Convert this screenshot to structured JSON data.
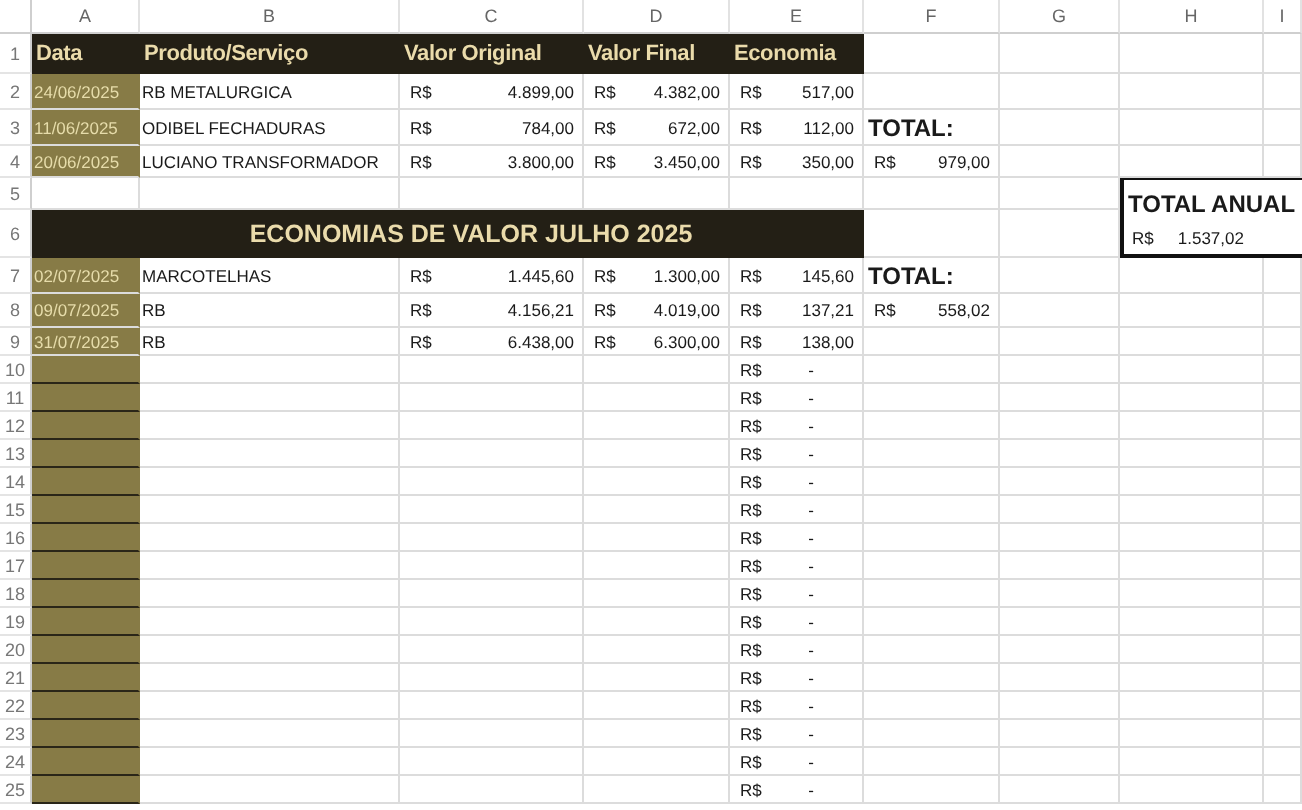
{
  "columns": [
    "A",
    "B",
    "C",
    "D",
    "E",
    "F",
    "G",
    "H",
    "I"
  ],
  "rows": [
    {
      "number": "1",
      "kind": "header",
      "labels": [
        "Data",
        "Produto/Serviço",
        "Valor Original",
        "Valor Final",
        "Economia"
      ]
    },
    {
      "number": "2",
      "kind": "entry",
      "date": "24/06/2025",
      "product": "RB METALURGICA",
      "original": {
        "symbol": "R$",
        "amount": "4.899,00"
      },
      "final": {
        "symbol": "R$",
        "amount": "4.382,00"
      },
      "economy": {
        "symbol": "R$",
        "amount": "517,00"
      }
    },
    {
      "number": "3",
      "kind": "entry",
      "date": "11/06/2025",
      "product": "ODIBEL FECHADURAS",
      "original": {
        "symbol": "R$",
        "amount": "784,00"
      },
      "final": {
        "symbol": "R$",
        "amount": "672,00"
      },
      "economy": {
        "symbol": "R$",
        "amount": "112,00"
      },
      "extra": {
        "kind": "total-label",
        "text": "TOTAL:"
      }
    },
    {
      "number": "4",
      "kind": "entry",
      "date": "20/06/2025",
      "product": "LUCIANO TRANSFORMADOR",
      "original": {
        "symbol": "R$",
        "amount": "3.800,00"
      },
      "final": {
        "symbol": "R$",
        "amount": "3.450,00"
      },
      "economy": {
        "symbol": "R$",
        "amount": "350,00"
      },
      "extra": {
        "kind": "amount",
        "symbol": "R$",
        "amount": "979,00"
      }
    },
    {
      "number": "5",
      "kind": "blank"
    },
    {
      "number": "6",
      "kind": "banner",
      "title": "ECONOMIAS DE VALOR JULHO 2025"
    },
    {
      "number": "7",
      "kind": "entry",
      "date": "02/07/2025",
      "product": "MARCOTELHAS",
      "original": {
        "symbol": "R$",
        "amount": "1.445,60"
      },
      "final": {
        "symbol": "R$",
        "amount": "1.300,00"
      },
      "economy": {
        "symbol": "R$",
        "amount": "145,60"
      },
      "extra": {
        "kind": "total-label",
        "text": "TOTAL:"
      }
    },
    {
      "number": "8",
      "kind": "entry",
      "date": "09/07/2025",
      "product": "RB",
      "original": {
        "symbol": "R$",
        "amount": "4.156,21"
      },
      "final": {
        "symbol": "R$",
        "amount": "4.019,00"
      },
      "economy": {
        "symbol": "R$",
        "amount": "137,21"
      },
      "extra": {
        "kind": "amount",
        "symbol": "R$",
        "amount": "558,02"
      }
    },
    {
      "number": "9",
      "kind": "entry",
      "date": "31/07/2025",
      "product": "RB",
      "original": {
        "symbol": "R$",
        "amount": "6.438,00"
      },
      "final": {
        "symbol": "R$",
        "amount": "6.300,00"
      },
      "economy": {
        "symbol": "R$",
        "amount": "138,00"
      }
    },
    {
      "number": "10",
      "kind": "filler",
      "economy": {
        "symbol": "R$",
        "amount": "-"
      }
    },
    {
      "number": "11",
      "kind": "filler",
      "economy": {
        "symbol": "R$",
        "amount": "-"
      }
    },
    {
      "number": "12",
      "kind": "filler",
      "economy": {
        "symbol": "R$",
        "amount": "-"
      }
    },
    {
      "number": "13",
      "kind": "filler",
      "economy": {
        "symbol": "R$",
        "amount": "-"
      }
    },
    {
      "number": "14",
      "kind": "filler",
      "economy": {
        "symbol": "R$",
        "amount": "-"
      }
    },
    {
      "number": "15",
      "kind": "filler",
      "economy": {
        "symbol": "R$",
        "amount": "-"
      }
    },
    {
      "number": "16",
      "kind": "filler",
      "economy": {
        "symbol": "R$",
        "amount": "-"
      }
    },
    {
      "number": "17",
      "kind": "filler",
      "economy": {
        "symbol": "R$",
        "amount": "-"
      }
    },
    {
      "number": "18",
      "kind": "filler",
      "economy": {
        "symbol": "R$",
        "amount": "-"
      }
    },
    {
      "number": "19",
      "kind": "filler",
      "economy": {
        "symbol": "R$",
        "amount": "-"
      }
    },
    {
      "number": "20",
      "kind": "filler",
      "economy": {
        "symbol": "R$",
        "amount": "-"
      }
    },
    {
      "number": "21",
      "kind": "filler",
      "economy": {
        "symbol": "R$",
        "amount": "-"
      }
    },
    {
      "number": "22",
      "kind": "filler",
      "economy": {
        "symbol": "R$",
        "amount": "-"
      }
    },
    {
      "number": "23",
      "kind": "filler",
      "economy": {
        "symbol": "R$",
        "amount": "-"
      }
    },
    {
      "number": "24",
      "kind": "filler",
      "economy": {
        "symbol": "R$",
        "amount": "-"
      }
    },
    {
      "number": "25",
      "kind": "filler",
      "economy": {
        "symbol": "R$",
        "amount": "-"
      }
    }
  ],
  "annual_total": {
    "label": "TOTAL ANUAL",
    "symbol": "R$",
    "amount": "1.537,02"
  }
}
